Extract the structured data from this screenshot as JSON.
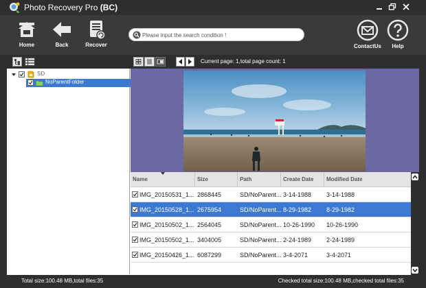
{
  "window": {
    "title": "Photo Recovery Pro",
    "edition": "(BC)"
  },
  "toolbar": {
    "home_label": "Home",
    "back_label": "Back",
    "recover_label": "Recover",
    "contact_label": "ContactUs",
    "help_label": "Help"
  },
  "search": {
    "placeholder": "Please input the search condition !",
    "value": ""
  },
  "pagination": {
    "info": "Current page: 1,total page count: 1"
  },
  "tree": {
    "root_label": "SD",
    "folder_label": "NoParentFolder"
  },
  "table": {
    "columns": [
      "Name",
      "Size",
      "Path",
      "Create Date",
      "Modified Date"
    ],
    "sort_column": "Name",
    "selected_row": 1,
    "rows": [
      {
        "name": "IMG_20150531_1...",
        "size": "2868445",
        "path": "SD/NoParent...",
        "created": "3-14-1988",
        "modified": "3-14-1988",
        "checked": true
      },
      {
        "name": "IMG_20150528_1...",
        "size": "2675954",
        "path": "SD/NoParent...",
        "created": "8-29-1982",
        "modified": "8-29-1982",
        "checked": true
      },
      {
        "name": "IMG_20150502_1...",
        "size": "2564045",
        "path": "SD/NoParent...",
        "created": "10-26-1990",
        "modified": "10-26-1990",
        "checked": true
      },
      {
        "name": "IMG_20150502_1...",
        "size": "3404005",
        "path": "SD/NoParent...",
        "created": "2-24-1989",
        "modified": "2-24-1989",
        "checked": true
      },
      {
        "name": "IMG_20150426_1...",
        "size": "6087299",
        "path": "SD/NoParent...",
        "created": "3-4-2071",
        "modified": "3-4-2071",
        "checked": true
      }
    ]
  },
  "status": {
    "left": "Total size:100.48 MB,total files:35",
    "right": "Checked total size:100.48 MB,checked total files:35"
  },
  "colors": {
    "chrome": "#2e2e2e",
    "toolbar": "#3a3a3a",
    "selection": "#3b79d2",
    "preview_bg": "#6b68a4"
  }
}
